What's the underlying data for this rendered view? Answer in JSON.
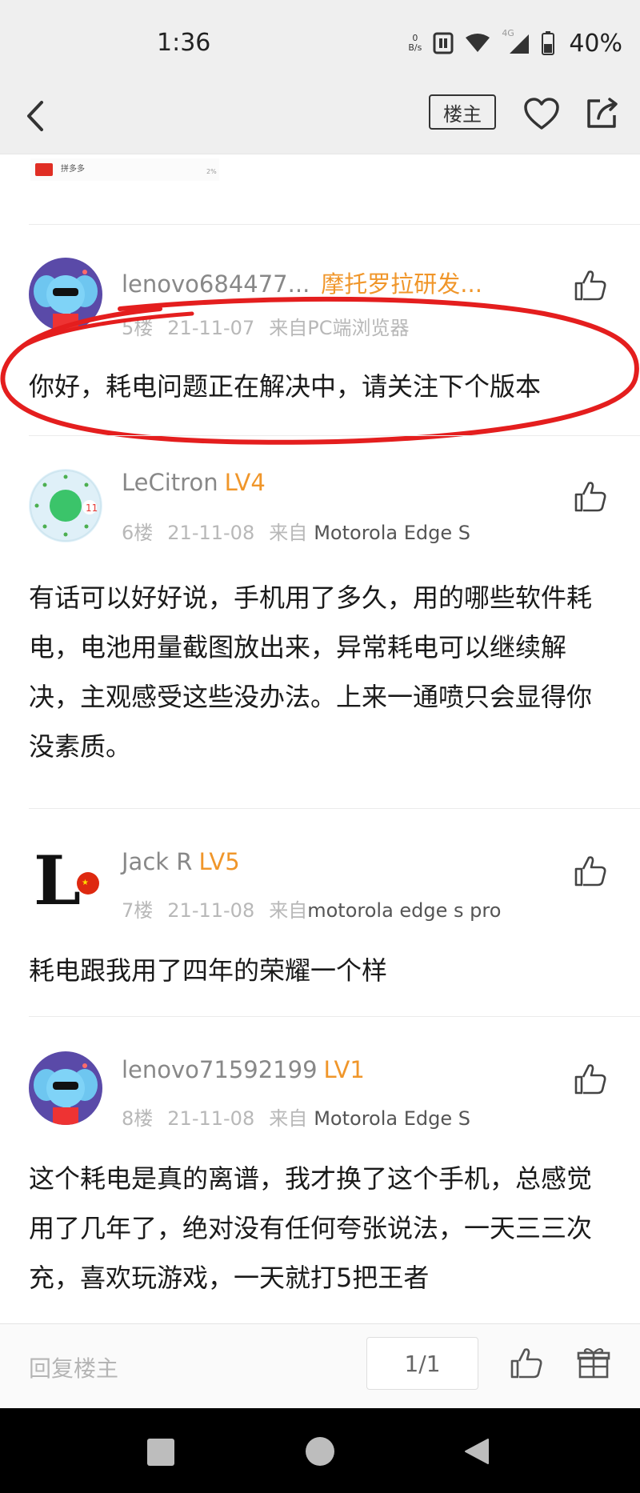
{
  "status": {
    "time": "1:36",
    "net_speed_value": "0",
    "net_speed_unit": "B/s",
    "network": "4G",
    "battery": "40%"
  },
  "toolbar": {
    "louzhu_label": "楼主",
    "back_icon": "chevron-left-icon",
    "favorite_icon": "heart-icon",
    "share_icon": "share-icon"
  },
  "ad": {
    "name": "拼多多",
    "percent": "2%",
    "brand_color": "#e02e24"
  },
  "posts": [
    {
      "username": "lenovo684477...",
      "level": "",
      "tag": "摩托罗拉研发...",
      "floor": "5楼",
      "date": "21-11-07",
      "source": "来自PC端浏览器",
      "content": "你好，耗电问题正在解决中，请关注下个版本"
    },
    {
      "username": "LeCitron",
      "level": "LV4",
      "floor": "6楼",
      "date": "21-11-08",
      "source_prefix": "来自",
      "source": "Motorola Edge S",
      "content": "有话可以好好说，手机用了多久，用的哪些软件耗电，电池用量截图放出来，异常耗电可以继续解决，主观感受这些没办法。上来一通喷只会显得你没素质。"
    },
    {
      "username": "Jack R",
      "level": "LV5",
      "floor": "7楼",
      "date": "21-11-08",
      "source_prefix": "来自",
      "source": "motorola edge s pro",
      "content": "耗电跟我用了四年的荣耀一个样"
    },
    {
      "username": "lenovo71592199",
      "level": "LV1",
      "floor": "8楼",
      "date": "21-11-08",
      "source_prefix": "来自",
      "source": "Motorola Edge S",
      "content": "这个耗电是真的离谱，我才换了这个手机，总感觉用了几年了，绝对没有任何夸张说法，一天三三次充，喜欢玩游戏，一天就打5把王者"
    }
  ],
  "bottom": {
    "reply_placeholder": "回复楼主",
    "page_indicator": "1/1"
  },
  "colors": {
    "level_accent": "#f0962a",
    "annotation_red": "#e41e1e",
    "header_bg": "#efefef"
  }
}
